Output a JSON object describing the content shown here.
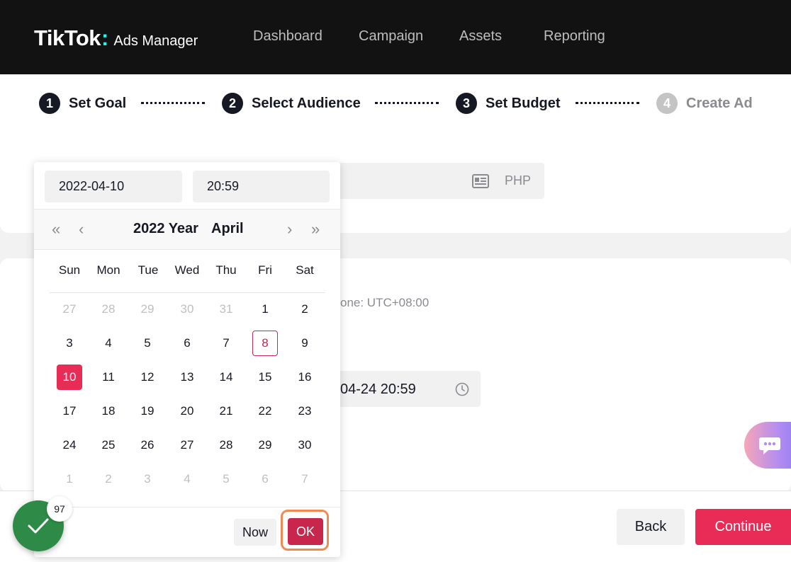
{
  "header": {
    "brand": "TikTok",
    "product": "Ads Manager",
    "nav": [
      "Dashboard",
      "Campaign",
      "Assets",
      "Reporting"
    ]
  },
  "steps": [
    {
      "num": "1",
      "label": "Set Goal"
    },
    {
      "num": "2",
      "label": "Select Audience"
    },
    {
      "num": "3",
      "label": "Set Budget"
    },
    {
      "num": "4",
      "label": "Create Ad"
    }
  ],
  "budget": {
    "currency": "PHP"
  },
  "schedule": {
    "timezone_fragment": "one: UTC+08:00",
    "end_fragment": "04-24 20:59"
  },
  "picker": {
    "date_value": "2022-04-10",
    "time_value": "20:59",
    "year_label": "2022 Year",
    "month_label": "April",
    "weekdays": [
      "Sun",
      "Mon",
      "Tue",
      "Wed",
      "Thu",
      "Fri",
      "Sat"
    ],
    "days": [
      "27",
      "28",
      "29",
      "30",
      "31",
      "1",
      "2",
      "3",
      "4",
      "5",
      "6",
      "7",
      "8",
      "9",
      "10",
      "11",
      "12",
      "13",
      "14",
      "15",
      "16",
      "17",
      "18",
      "19",
      "20",
      "21",
      "22",
      "23",
      "24",
      "25",
      "26",
      "27",
      "28",
      "29",
      "30",
      "1",
      "2",
      "3",
      "4",
      "5",
      "6",
      "7"
    ],
    "now_label": "Now",
    "ok_label": "OK"
  },
  "footer": {
    "back_label": "Back",
    "continue_label": "Continue"
  },
  "badge": {
    "count": "97"
  },
  "colors": {
    "accent": "#e82c56",
    "ok": "#c8264d",
    "header_bg": "#121212",
    "success": "#2e8b47"
  }
}
